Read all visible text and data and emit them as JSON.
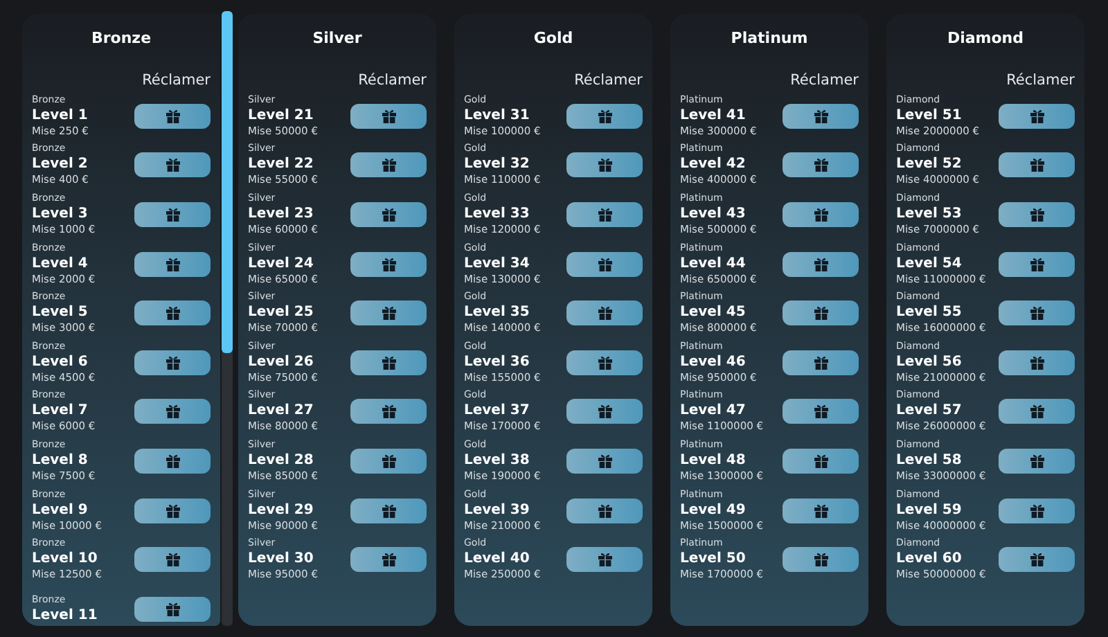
{
  "tiers": [
    {
      "name": "Bronze",
      "claim_label": "Réclamer",
      "scrollable": true,
      "levels": [
        {
          "tier": "Bronze",
          "level": "Level 1",
          "bet": "Mise 250 €"
        },
        {
          "tier": "Bronze",
          "level": "Level 2",
          "bet": "Mise 400 €"
        },
        {
          "tier": "Bronze",
          "level": "Level 3",
          "bet": "Mise 1000 €"
        },
        {
          "tier": "Bronze",
          "level": "Level 4",
          "bet": "Mise 2000 €"
        },
        {
          "tier": "Bronze",
          "level": "Level 5",
          "bet": "Mise 3000 €"
        },
        {
          "tier": "Bronze",
          "level": "Level 6",
          "bet": "Mise 4500 €"
        },
        {
          "tier": "Bronze",
          "level": "Level 7",
          "bet": "Mise 6000 €"
        },
        {
          "tier": "Bronze",
          "level": "Level 8",
          "bet": "Mise 7500 €"
        },
        {
          "tier": "Bronze",
          "level": "Level 9",
          "bet": "Mise 10000 €"
        },
        {
          "tier": "Bronze",
          "level": "Level 10",
          "bet": "Mise 12500 €"
        },
        {
          "tier": "Bronze",
          "level": "Level 11"
        }
      ]
    },
    {
      "name": "Silver",
      "claim_label": "Réclamer",
      "scrollable": false,
      "levels": [
        {
          "tier": "Silver",
          "level": "Level 21",
          "bet": "Mise 50000 €"
        },
        {
          "tier": "Silver",
          "level": "Level 22",
          "bet": "Mise 55000 €"
        },
        {
          "tier": "Silver",
          "level": "Level 23",
          "bet": "Mise 60000 €"
        },
        {
          "tier": "Silver",
          "level": "Level 24",
          "bet": "Mise 65000 €"
        },
        {
          "tier": "Silver",
          "level": "Level 25",
          "bet": "Mise 70000 €"
        },
        {
          "tier": "Silver",
          "level": "Level 26",
          "bet": "Mise 75000 €"
        },
        {
          "tier": "Silver",
          "level": "Level 27",
          "bet": "Mise 80000 €"
        },
        {
          "tier": "Silver",
          "level": "Level 28",
          "bet": "Mise 85000 €"
        },
        {
          "tier": "Silver",
          "level": "Level 29",
          "bet": "Mise 90000 €"
        },
        {
          "tier": "Silver",
          "level": "Level 30",
          "bet": "Mise 95000 €"
        }
      ]
    },
    {
      "name": "Gold",
      "claim_label": "Réclamer",
      "scrollable": false,
      "levels": [
        {
          "tier": "Gold",
          "level": "Level 31",
          "bet": "Mise 100000 €"
        },
        {
          "tier": "Gold",
          "level": "Level 32",
          "bet": "Mise 110000 €"
        },
        {
          "tier": "Gold",
          "level": "Level 33",
          "bet": "Mise 120000 €"
        },
        {
          "tier": "Gold",
          "level": "Level 34",
          "bet": "Mise 130000 €"
        },
        {
          "tier": "Gold",
          "level": "Level 35",
          "bet": "Mise 140000 €"
        },
        {
          "tier": "Gold",
          "level": "Level 36",
          "bet": "Mise 155000 €"
        },
        {
          "tier": "Gold",
          "level": "Level 37",
          "bet": "Mise 170000 €"
        },
        {
          "tier": "Gold",
          "level": "Level 38",
          "bet": "Mise 190000 €"
        },
        {
          "tier": "Gold",
          "level": "Level 39",
          "bet": "Mise 210000 €"
        },
        {
          "tier": "Gold",
          "level": "Level 40",
          "bet": "Mise 250000 €"
        }
      ]
    },
    {
      "name": "Platinum",
      "claim_label": "Réclamer",
      "scrollable": false,
      "levels": [
        {
          "tier": "Platinum",
          "level": "Level 41",
          "bet": "Mise 300000 €"
        },
        {
          "tier": "Platinum",
          "level": "Level 42",
          "bet": "Mise 400000 €"
        },
        {
          "tier": "Platinum",
          "level": "Level 43",
          "bet": "Mise 500000 €"
        },
        {
          "tier": "Platinum",
          "level": "Level 44",
          "bet": "Mise 650000 €"
        },
        {
          "tier": "Platinum",
          "level": "Level 45",
          "bet": "Mise 800000 €"
        },
        {
          "tier": "Platinum",
          "level": "Level 46",
          "bet": "Mise 950000 €"
        },
        {
          "tier": "Platinum",
          "level": "Level 47",
          "bet": "Mise 1100000 €"
        },
        {
          "tier": "Platinum",
          "level": "Level 48",
          "bet": "Mise 1300000 €"
        },
        {
          "tier": "Platinum",
          "level": "Level 49",
          "bet": "Mise 1500000 €"
        },
        {
          "tier": "Platinum",
          "level": "Level 50",
          "bet": "Mise 1700000 €"
        }
      ]
    },
    {
      "name": "Diamond",
      "claim_label": "Réclamer",
      "scrollable": false,
      "levels": [
        {
          "tier": "Diamond",
          "level": "Level 51",
          "bet": "Mise 2000000 €"
        },
        {
          "tier": "Diamond",
          "level": "Level 52",
          "bet": "Mise 4000000 €"
        },
        {
          "tier": "Diamond",
          "level": "Level 53",
          "bet": "Mise 7000000 €"
        },
        {
          "tier": "Diamond",
          "level": "Level 54",
          "bet": "Mise 11000000 €"
        },
        {
          "tier": "Diamond",
          "level": "Level 55",
          "bet": "Mise 16000000 €"
        },
        {
          "tier": "Diamond",
          "level": "Level 56",
          "bet": "Mise 21000000 €"
        },
        {
          "tier": "Diamond",
          "level": "Level 57",
          "bet": "Mise 26000000 €"
        },
        {
          "tier": "Diamond",
          "level": "Level 58",
          "bet": "Mise 33000000 €"
        },
        {
          "tier": "Diamond",
          "level": "Level 59",
          "bet": "Mise 40000000 €"
        },
        {
          "tier": "Diamond",
          "level": "Level 60",
          "bet": "Mise 50000000 €"
        }
      ]
    }
  ]
}
